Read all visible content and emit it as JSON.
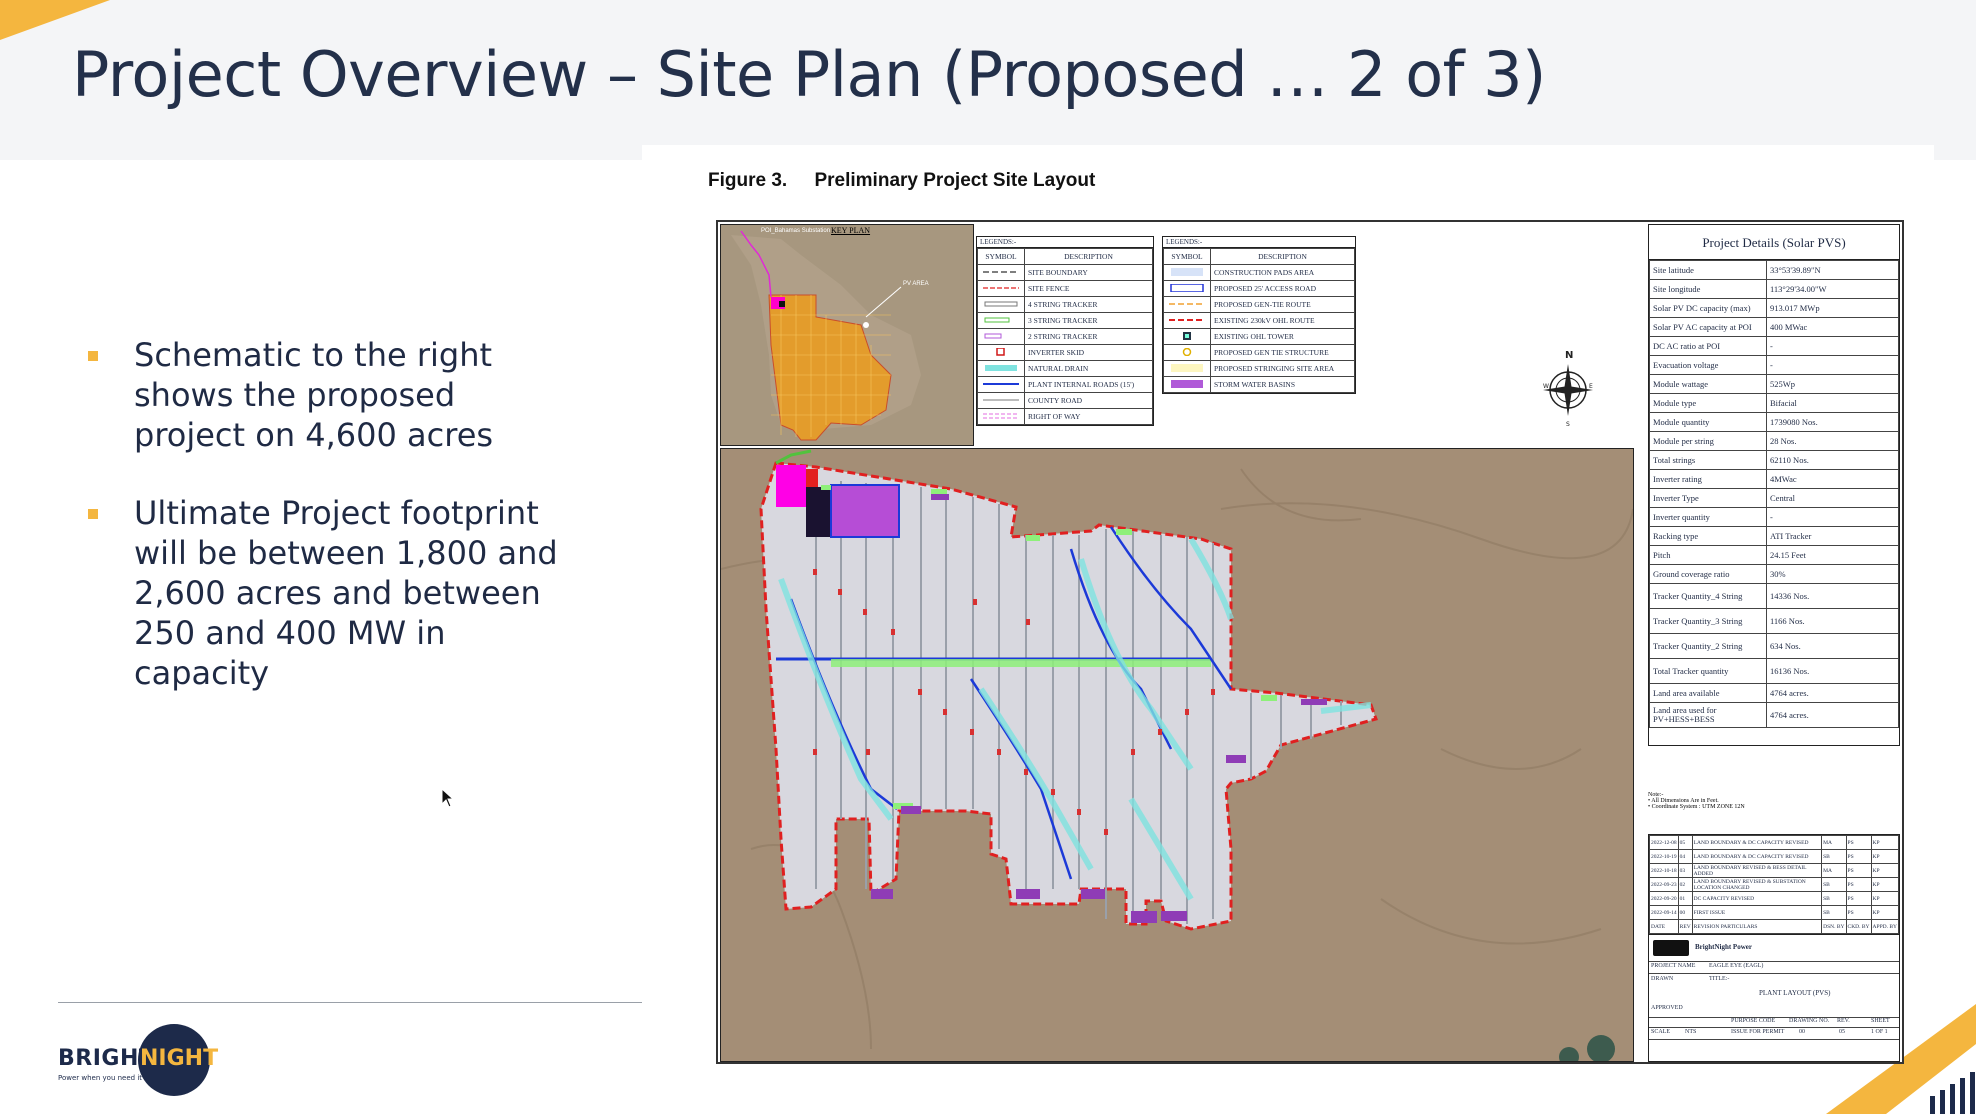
{
  "slide": {
    "title": "Project Overview – Site Plan (Proposed … 2 of 3)",
    "bullets": [
      "Schematic to the right shows the proposed project on 4,600 acres",
      "Ultimate Project footprint will be between 1,800 and 2,600 acres and between 250 and 400 MW in capacity"
    ],
    "accent_color": "#f4b63f",
    "title_color": "#23304a"
  },
  "logo": {
    "brand_left": "BRIGHT",
    "brand_right": "NIGHT",
    "tagline": "Power when you need it"
  },
  "figure": {
    "number": "Figure 3.",
    "caption": "Preliminary Project Site Layout",
    "key_plan_title": "KEY PLAN",
    "key_plan_labels": [
      "POI_Bahamas Substation",
      "PV AREA"
    ],
    "legend_left": {
      "heading": "LEGENDS:-",
      "col_symbol": "SYMBOL",
      "col_desc": "DESCRIPTION",
      "items": [
        "SITE BOUNDARY",
        "SITE FENCE",
        "4 STRING TRACKER",
        "3 STRING TRACKER",
        "2 STRING TRACKER",
        "INVERTER SKID",
        "NATURAL DRAIN",
        "PLANT INTERNAL ROADS (15')",
        "COUNTY ROAD",
        "RIGHT OF WAY"
      ]
    },
    "legend_right": {
      "heading": "LEGENDS:-",
      "col_symbol": "SYMBOL",
      "col_desc": "DESCRIPTION",
      "items": [
        "CONSTRUCTION PADS AREA",
        "PROPOSED 25' ACCESS ROAD",
        "PROPOSED GEN-TIE ROUTE",
        "EXISTING 230kV OHL ROUTE",
        "EXISTING OHL TOWER",
        "PROPOSED GEN TIE STRUCTURE",
        "PROPOSED STRINGING SITE AREA",
        "STORM WATER BASINS"
      ]
    },
    "compass": {
      "n": "N",
      "e": "E",
      "w": "W",
      "s": "S"
    },
    "project_details": {
      "heading": "Project Details  (Solar PVS)",
      "rows": [
        [
          "Site latitude",
          "33°53'39.89\"N"
        ],
        [
          "Site longitude",
          "113°29'34.00\"W"
        ],
        [
          "Solar PV DC capacity (max)",
          "913.017 MWp"
        ],
        [
          "Solar PV AC capacity at POI",
          "400 MWac"
        ],
        [
          "DC AC ratio at POI",
          "-"
        ],
        [
          "Evacuation voltage",
          "-"
        ],
        [
          "Module wattage",
          "525Wp"
        ],
        [
          "Module type",
          "Bifacial"
        ],
        [
          "Module quantity",
          "1739080 Nos."
        ],
        [
          "Module per string",
          "28 Nos."
        ],
        [
          "Total strings",
          "62110 Nos."
        ],
        [
          "Inverter rating",
          "4MWac"
        ],
        [
          "Inverter Type",
          "Central"
        ],
        [
          "Inverter quantity",
          "-"
        ],
        [
          "Racking type",
          "ATI Tracker"
        ],
        [
          "Pitch",
          "24.15 Feet"
        ],
        [
          "Ground coverage ratio",
          "30%"
        ],
        [
          "Tracker Quantity_4 String",
          "14336 Nos."
        ],
        [
          "Tracker Quantity_3 String",
          "1166 Nos."
        ],
        [
          "Tracker Quantity_2 String",
          "634 Nos."
        ],
        [
          "Total Tracker quantity",
          "16136 Nos."
        ],
        [
          "Land area available",
          "4764 acres."
        ],
        [
          "Land area used for PV+HESS+BESS",
          "4764 acres."
        ]
      ]
    },
    "notes": [
      "Note:-",
      "• All Dimensions Are in Feet.",
      "• Coordinate System : UTM ZONE 12N"
    ],
    "revisions": [
      [
        "2022-12-08",
        "05",
        "LAND BOUNDARY & DC CAPACITY REVISED",
        "MA",
        "PS",
        "KP"
      ],
      [
        "2022-10-19",
        "04",
        "LAND BOUNDARY & DC CAPACITY REVISED",
        "SB",
        "PS",
        "KP"
      ],
      [
        "2022-10-18",
        "03",
        "LAND BOUNDARY REVISED & BESS DETAIL ADDED",
        "MA",
        "PS",
        "KP"
      ],
      [
        "2022-09-23",
        "02",
        "LAND BOUNDARY REVISED & SUBSTATION LOCATION CHANGED",
        "SB",
        "PS",
        "KP"
      ],
      [
        "2022-09-20",
        "01",
        "DC CAPACITY REVISED",
        "SB",
        "PS",
        "KP"
      ],
      [
        "2022-09-14",
        "00",
        "FIRST ISSUE",
        "SB",
        "PS",
        "KP"
      ]
    ],
    "rev_header": [
      "DATE",
      "REV",
      "REVISION PARTICULARS",
      "DSN. BY",
      "CKD. BY",
      "APPD. BY"
    ],
    "title_block": {
      "company": "BrightNight Power",
      "project_label": "PROJECT NAME",
      "project_name": "EAGLE EYE (EAGL)",
      "drawn": "DRAWN",
      "title_label": "TITLE:-",
      "title": "PLANT LAYOUT (PVS)",
      "approved": "APPROVED",
      "purpose_label": "PURPOSE CODE",
      "drawing_label": "DRAWING NO.",
      "rev_label": "REV.",
      "sheet_label": "SHEET",
      "scale_label": "SCALE",
      "scale": "NTS",
      "purpose": "ISSUE FOR PERMIT",
      "drawing_no": "00",
      "rev": "05",
      "sheet": "1 OF 1"
    }
  }
}
